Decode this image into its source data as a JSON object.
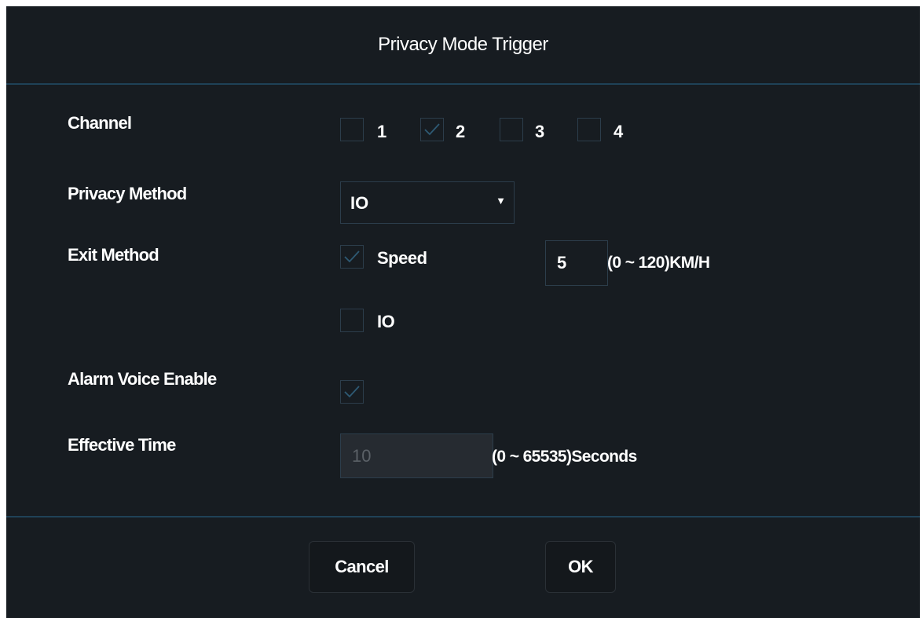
{
  "dialog": {
    "title": "Privacy Mode Trigger"
  },
  "channel": {
    "label": "Channel",
    "options": [
      {
        "label": "1",
        "checked": false
      },
      {
        "label": "2",
        "checked": true
      },
      {
        "label": "3",
        "checked": false
      },
      {
        "label": "4",
        "checked": false
      }
    ]
  },
  "privacy_method": {
    "label": "Privacy Method",
    "value": "IO"
  },
  "exit_method": {
    "label": "Exit Method",
    "speed_label": "Speed",
    "speed_checked": true,
    "speed_value": "5",
    "speed_hint": "(0 ~ 120)KM/H",
    "io_label": "IO",
    "io_checked": false
  },
  "alarm_voice": {
    "label": "Alarm Voice Enable",
    "checked": true
  },
  "effective_time": {
    "label": "Effective Time",
    "value": "10",
    "hint": "(0 ~ 65535)Seconds"
  },
  "buttons": {
    "cancel": "Cancel",
    "ok": "OK"
  },
  "colors": {
    "background": "#171c21",
    "border": "#2c3d4b",
    "divider": "#1f4257",
    "check": "#2e5a74"
  }
}
